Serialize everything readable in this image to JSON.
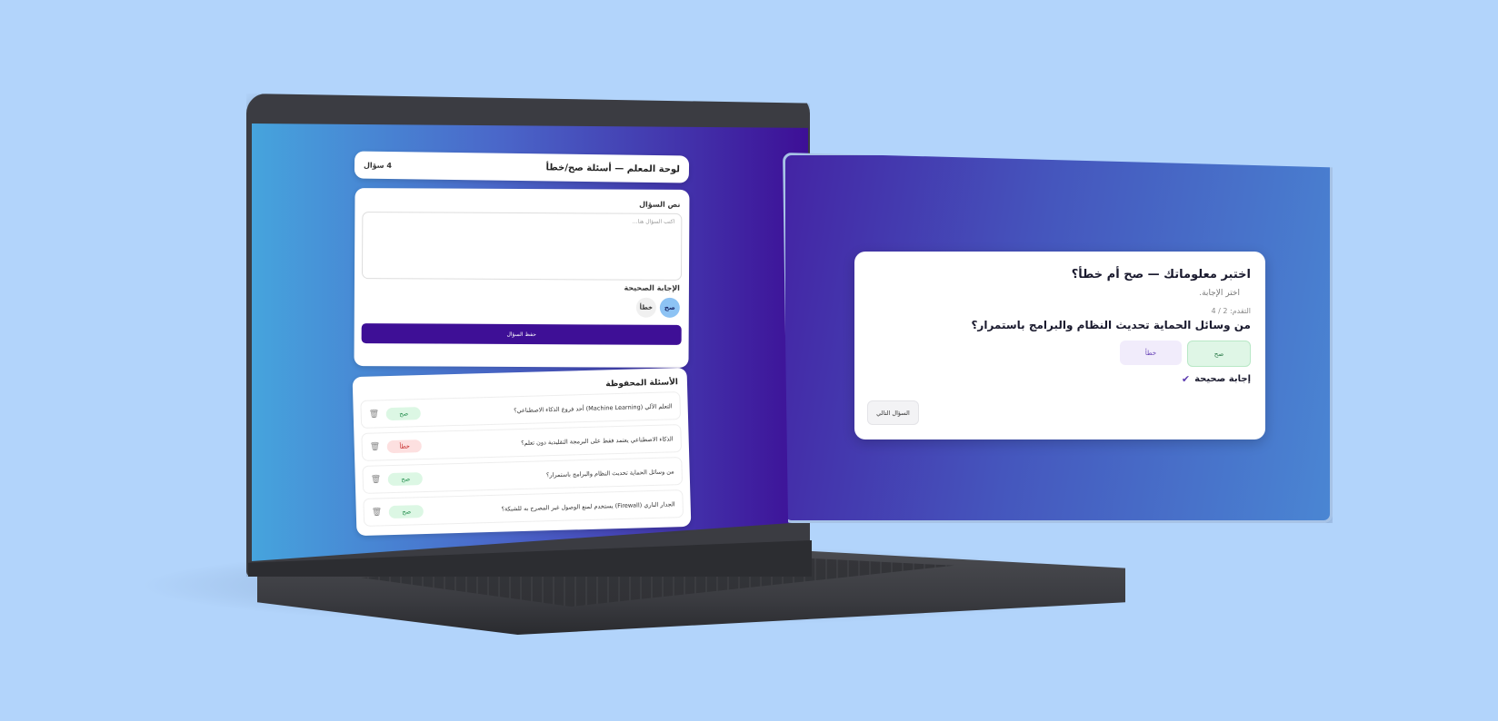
{
  "teacher": {
    "title": "لوحة المعلم — أسئلة صح/خطأ",
    "count": "4 سؤال",
    "question_label": "نص السؤال",
    "question_placeholder": "اكتب السؤال هنا...",
    "correct_answer_label": "الإجابة الصحيحة",
    "answer_options": [
      "صح",
      "خطأ"
    ],
    "selected_answer": "صح",
    "save_button": "حفظ السؤال",
    "saved_title": "الأسئلة المحفوظة",
    "saved_questions": [
      {
        "text": "التعلم الآلي (Machine Learning) أحد فروع الذكاء الاصطناعي؟",
        "answer": "صح"
      },
      {
        "text": "الذكاء الاصطناعي يعتمد فقط على البرمجة التقليدية دون تعلم؟",
        "answer": "خطأ"
      },
      {
        "text": "من وسائل الحماية تحديث النظام والبرامج باستمرار؟",
        "answer": "صح"
      },
      {
        "text": "الجدار الناري (Firewall) يستخدم لمنع الوصول غير المصرح به للشبكة؟",
        "answer": "صح"
      }
    ]
  },
  "quiz": {
    "title": "اختبر معلوماتك — صح أم خطأ؟",
    "subtitle": "اختر الإجابة.",
    "progress": "التقدم: 2 / 4",
    "question": "من وسائل الحماية تحديث النظام والبرامج باستمرار؟",
    "option_true": "صح",
    "option_false": "خطأ",
    "result": "إجابة صحيحة",
    "next_button": "السؤال التالي"
  },
  "colors": {
    "background": "#b2d4fb",
    "primary": "#3e0f96",
    "correct": "#1d8a48",
    "wrong": "#c62828"
  },
  "icons": [
    "trash-icon",
    "check-icon"
  ]
}
